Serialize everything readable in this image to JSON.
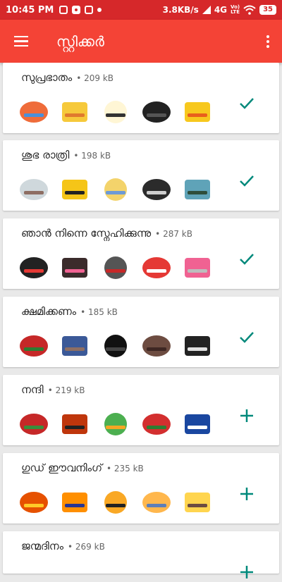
{
  "status_bar": {
    "time": "10:45 PM",
    "network_speed": "3.8KB/s",
    "network_type": "4G",
    "volte_top": "Vo)",
    "volte_bottom": "LTE",
    "battery": "35"
  },
  "app_bar": {
    "title": "സ്റ്റിക്കർ",
    "menu_icon": "menu-icon",
    "more_icon": "more-vert-icon"
  },
  "colors": {
    "status_bar": "#d6282a",
    "app_bar": "#f44336",
    "accent": "#00897b"
  },
  "packs": [
    {
      "name": "സുപ്രഭാതം",
      "size": "• 209 kB",
      "added": true,
      "stickers": [
        "flying-sun-sticker",
        "sun-greeting-sticker",
        "girl-sunrise-sticker",
        "birds-sticker",
        "smiling-sun-sticker"
      ]
    },
    {
      "name": "ശുഭ രാത്രി",
      "size": "• 198 kB",
      "added": true,
      "stickers": [
        "sleeping-cat-sticker",
        "yellow-moon-sticker",
        "fairy-moon-sticker",
        "crescent-moon-sticker",
        "night-landscape-sticker"
      ]
    },
    {
      "name": "ഞാൻ നിന്നെ സ്നേഹിക്കുന്നു",
      "size": "• 287 kB",
      "added": true,
      "stickers": [
        "penguin-heart-sticker",
        "love-dog-sticker",
        "couple-text-sticker",
        "heart-box-sticker",
        "arrow-heart-sticker"
      ]
    },
    {
      "name": "ക്ഷമിക്കണം",
      "size": "• 185 kB",
      "added": true,
      "stickers": [
        "flowers-sorry-sticker",
        "boy-sign-sticker",
        "silhouette-sticker",
        "teddy-bear-sticker",
        "banner-sticker"
      ]
    },
    {
      "name": "നന്ദി",
      "size": "• 219 kB",
      "added": false,
      "stickers": [
        "rose-heart-sticker",
        "thanks-text-sticker",
        "kid-thanks-sticker",
        "roses-sticker",
        "blue-badge-sticker"
      ]
    },
    {
      "name": "ഗുഡ് ഈവനിംഗ്",
      "size": "• 235 kB",
      "added": false,
      "stickers": [
        "sunset-oval-sticker",
        "sunset-sea-sticker",
        "birds-sunset-sticker",
        "evening-sky-sticker",
        "palm-sunset-sticker"
      ]
    },
    {
      "name": "ജന്മദിനം",
      "size": "• 269 kB",
      "added": false,
      "stickers": []
    }
  ]
}
